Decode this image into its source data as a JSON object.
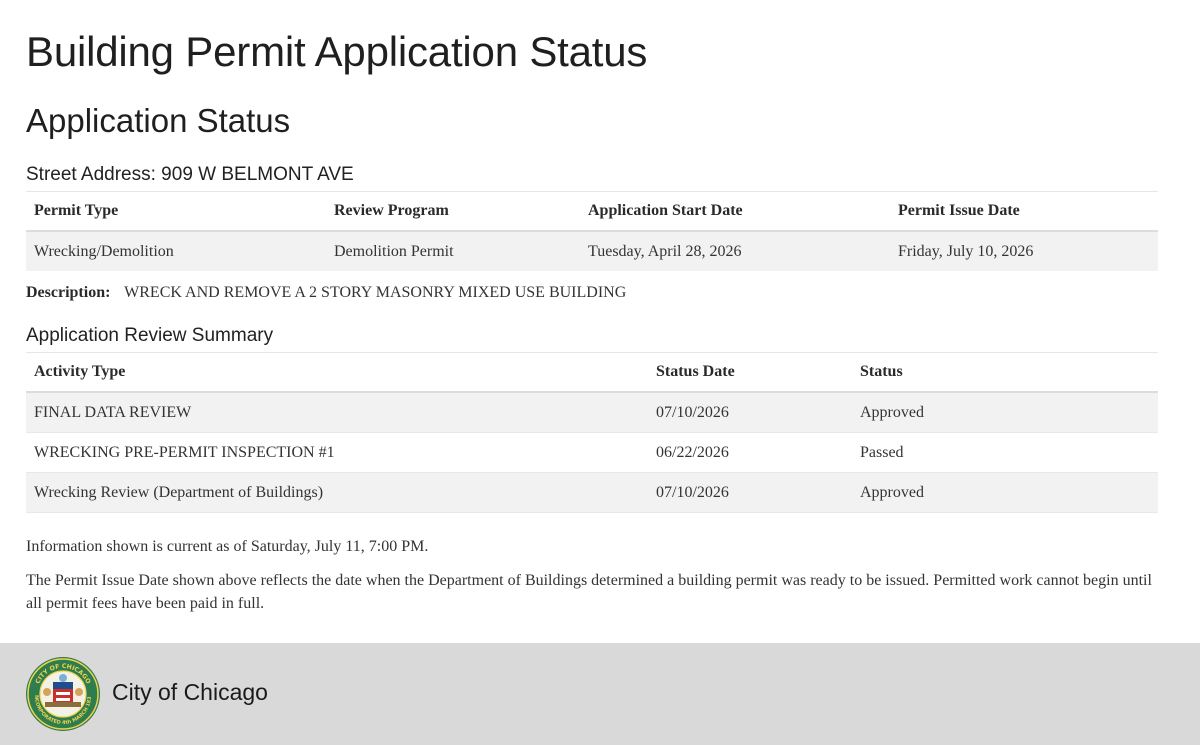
{
  "page_title": "Building Permit Application Status",
  "section_title": "Application Status",
  "address": "Street Address: 909 W BELMONT AVE",
  "permit_table": {
    "headers": [
      "Permit Type",
      "Review Program",
      "Application Start Date",
      "Permit Issue Date"
    ],
    "row": [
      "Wrecking/Demolition",
      "Demolition Permit",
      "Tuesday, April 28, 2026",
      "Friday, July 10, 2026"
    ]
  },
  "description": {
    "label": "Description:",
    "text": "WRECK AND REMOVE A 2 STORY MASONRY MIXED USE BUILDING"
  },
  "review_summary": {
    "title": "Application Review Summary",
    "headers": [
      "Activity Type",
      "Status Date",
      "Status"
    ],
    "rows": [
      [
        "FINAL DATA REVIEW",
        "07/10/2026",
        "Approved"
      ],
      [
        "WRECKING PRE-PERMIT INSPECTION #1",
        "06/22/2026",
        "Passed"
      ],
      [
        "Wrecking Review (Department of Buildings)",
        "07/10/2026",
        "Approved"
      ]
    ]
  },
  "notes": {
    "current": "Information shown is current as of Saturday, July 11, 7:00 PM.",
    "issue_date": "The Permit Issue Date shown above reflects the date when the Department of Buildings determined a building permit was ready to be issued. Permitted work cannot begin until all permit fees have been paid in full."
  },
  "footer": {
    "city_name": "City of Chicago",
    "seal_icon": "city-seal-icon",
    "seal_text_top": "CITY OF CHICAGO",
    "seal_text_bottom": "INCORPORATED 4th MARCH 1837"
  }
}
